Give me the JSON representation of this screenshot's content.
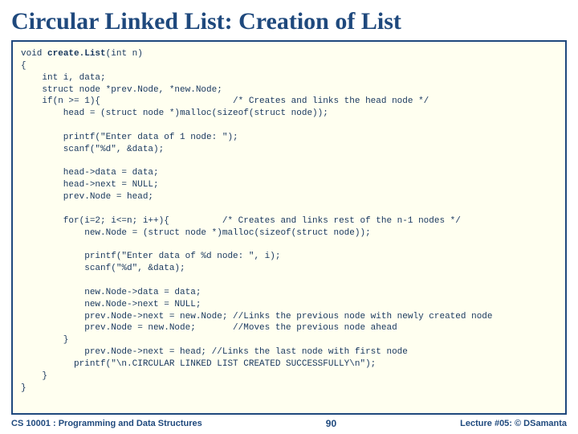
{
  "title": "Circular Linked List: Creation of List",
  "code_pre": "void ",
  "code_fn": "create.List",
  "code_post": "(int n)\n{\n    int i, data;\n    struct node *prev.Node, *new.Node;\n    if(n >= 1){                         /* Creates and links the head node */\n        head = (struct node *)malloc(sizeof(struct node));\n\n        printf(\"Enter data of 1 node: \");\n        scanf(\"%d\", &data);\n\n        head->data = data;\n        head->next = NULL;\n        prev.Node = head;\n\n        for(i=2; i<=n; i++){          /* Creates and links rest of the n-1 nodes */\n            new.Node = (struct node *)malloc(sizeof(struct node));\n\n            printf(\"Enter data of %d node: \", i);\n            scanf(\"%d\", &data);\n\n            new.Node->data = data;\n            new.Node->next = NULL;\n            prev.Node->next = new.Node; //Links the previous node with newly created node\n            prev.Node = new.Node;       //Moves the previous node ahead\n        }\n            prev.Node->next = head; //Links the last node with first node\n          printf(\"\\n.CIRCULAR LINKED LIST CREATED SUCCESSFULLY\\n\");\n    }\n}",
  "footer": {
    "left": "CS 10001 : Programming and Data Structures",
    "page": "90",
    "right": "Lecture #05: © DSamanta"
  }
}
